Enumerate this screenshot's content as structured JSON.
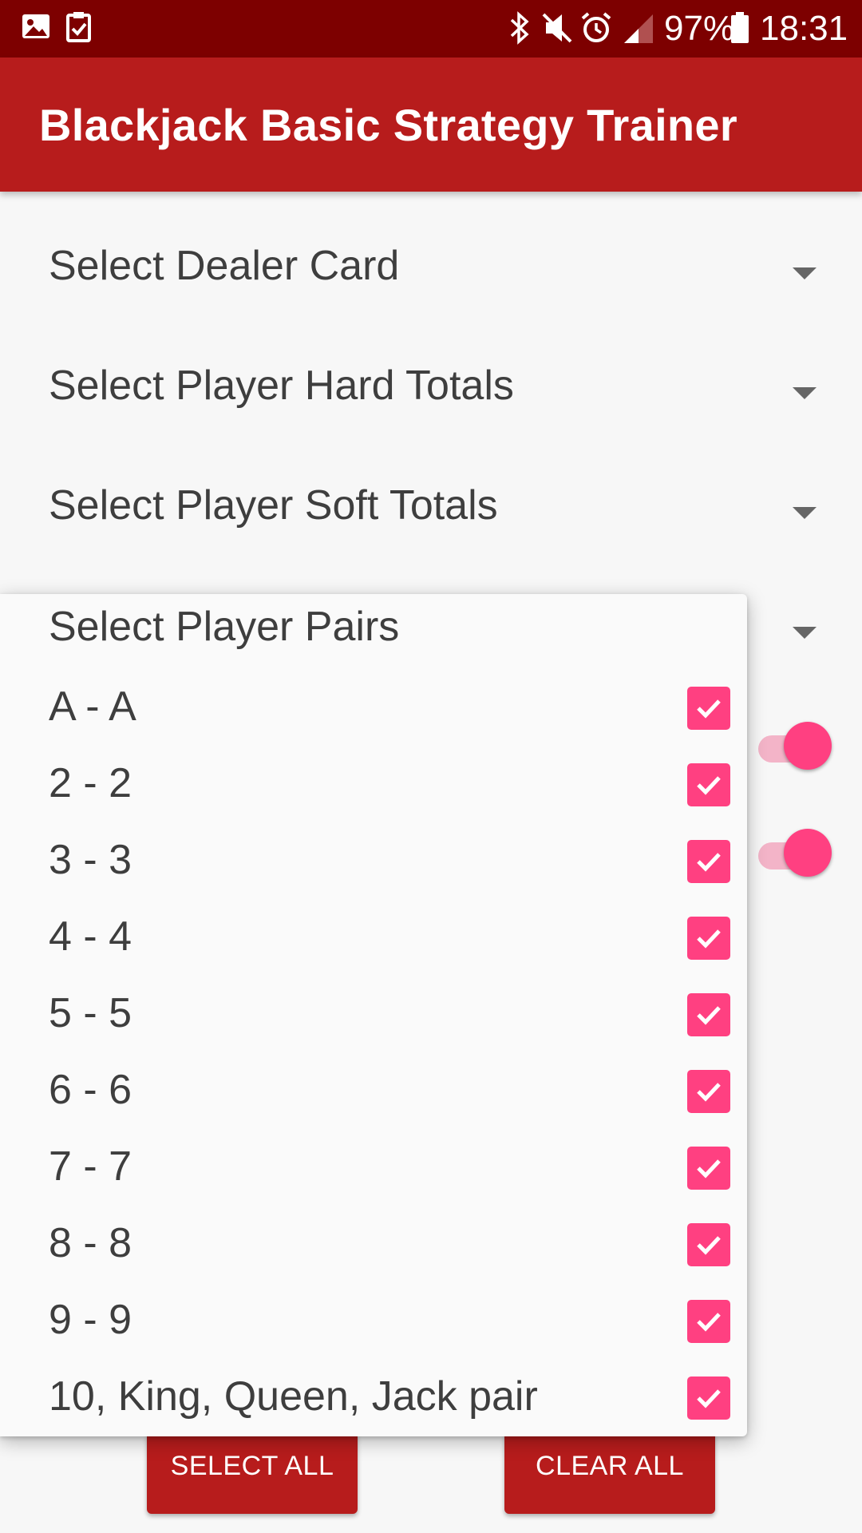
{
  "status_bar": {
    "battery_text": "97%",
    "time": "18:31",
    "icons": [
      "gallery-icon",
      "task-check-icon",
      "bluetooth-icon",
      "mute-icon",
      "alarm-icon",
      "signal-icon",
      "battery-icon"
    ]
  },
  "app_bar": {
    "title": "Blackjack Basic Strategy Trainer"
  },
  "spinners": [
    {
      "label": "Select Dealer Card"
    },
    {
      "label": "Select Player Hard Totals"
    },
    {
      "label": "Select Player Soft Totals"
    }
  ],
  "toggles": [
    {
      "on": true
    },
    {
      "on": true
    }
  ],
  "popup": {
    "title": "Select Player Pairs",
    "options": [
      {
        "label": "A - A",
        "checked": true
      },
      {
        "label": "2 - 2",
        "checked": true
      },
      {
        "label": "3 - 3",
        "checked": true
      },
      {
        "label": "4 - 4",
        "checked": true
      },
      {
        "label": "5 - 5",
        "checked": true
      },
      {
        "label": "6 - 6",
        "checked": true
      },
      {
        "label": "7 - 7",
        "checked": true
      },
      {
        "label": "8 - 8",
        "checked": true
      },
      {
        "label": "9 - 9",
        "checked": true
      },
      {
        "label": "10, King, Queen, Jack pair",
        "checked": true
      }
    ]
  },
  "buttons": {
    "select_all": "SELECT ALL",
    "clear_all": "CLEAR ALL"
  },
  "colors": {
    "status_bar": "#7d0000",
    "app_bar": "#b71c1c",
    "accent": "#ff4081",
    "button": "#b71c1c"
  }
}
